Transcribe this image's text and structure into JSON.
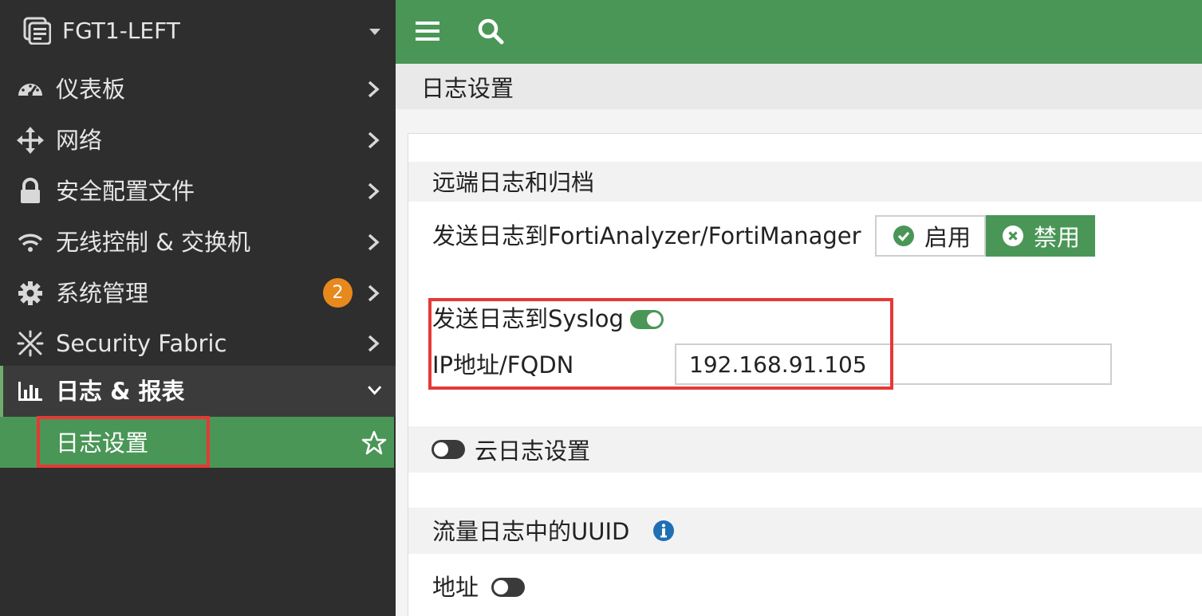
{
  "device": {
    "name": "FGT1-LEFT"
  },
  "sidebar": {
    "items": [
      {
        "label": "仪表板",
        "icon": "dashboard-icon"
      },
      {
        "label": "网络",
        "icon": "network-move-icon"
      },
      {
        "label": "安全配置文件",
        "icon": "lock-icon"
      },
      {
        "label": "无线控制 & 交换机",
        "icon": "wifi-icon"
      },
      {
        "label": "系统管理",
        "icon": "gear-icon",
        "badge": "2"
      },
      {
        "label": "Security Fabric",
        "icon": "fabric-icon"
      },
      {
        "label": "日志 & 报表",
        "icon": "bar-chart-icon",
        "expanded": true
      }
    ],
    "sub_item": {
      "label": "日志设置",
      "icon": "star-icon"
    }
  },
  "page": {
    "title": "日志设置"
  },
  "remote": {
    "section_title": "远端日志和归档",
    "fortianalyzer_label": "发送日志到FortiAnalyzer/FortiManager",
    "enable_label": "启用",
    "disable_label": "禁用",
    "selected": "禁用",
    "syslog_label": "发送日志到Syslog",
    "syslog_enabled": true,
    "ip_label": "IP地址/FQDN",
    "ip_value": "192.168.91.105"
  },
  "cloud": {
    "label": "云日志设置",
    "enabled": false
  },
  "uuid": {
    "section_title": "流量日志中的UUID",
    "address_label": "地址",
    "address_enabled": false
  },
  "colors": {
    "accent": "#4a9657",
    "sidebar": "#2e2e2e",
    "badge": "#e8891e",
    "highlight": "#e53935",
    "info": "#1f6fb5"
  }
}
